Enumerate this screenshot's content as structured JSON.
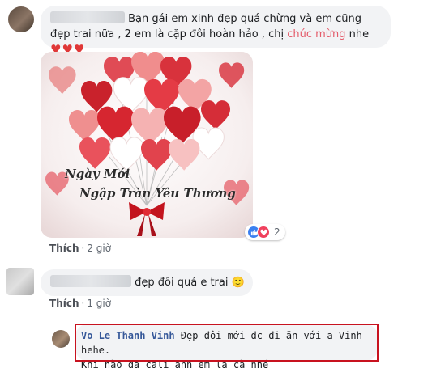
{
  "comments": [
    {
      "text": "Bạn gái em xinh đẹp quá chừng và em cũng đẹp trai nữa , 2 em là cặp đôi hoàn hảo , chị",
      "highlight": "chúc mừng",
      "after": " nhe",
      "hearts": "♥♥♥",
      "image_caption_line1": "Ngày Mới",
      "image_caption_line2": "Ngập Tràn Yêu Thương",
      "reaction_count": "2",
      "like_label": "Thích",
      "time": "2 giờ"
    },
    {
      "text": "đẹp đôi quá e trai",
      "emoji": "🙂",
      "like_label": "Thích",
      "time": "1 giờ"
    },
    {
      "author": "Vo Le Thanh Vinh",
      "text_line1": "Đẹp đôi mới dc đi ăn với a Vinh hehe.",
      "text_line2": "Khi nào qa cali anh em la cà nhé"
    }
  ],
  "colors": {
    "bubble": "#f2f3f5",
    "link": "#365899",
    "highlight_border": "#c8121f",
    "accent_text": "#e45b6a"
  },
  "icons": [
    "like-icon",
    "love-icon",
    "smile-emoji"
  ]
}
